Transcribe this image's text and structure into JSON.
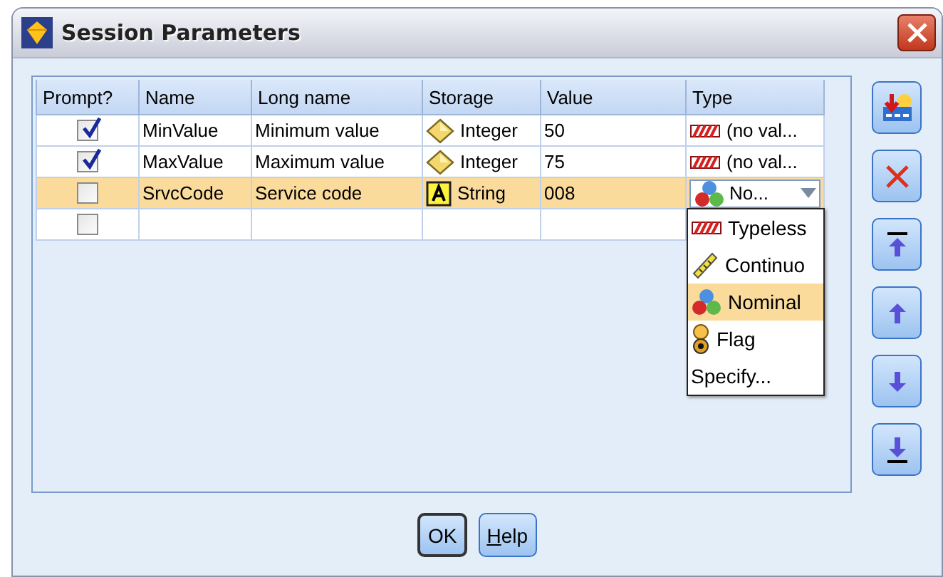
{
  "window": {
    "title": "Session Parameters"
  },
  "table": {
    "columns": [
      "Prompt?",
      "Name",
      "Long name",
      "Storage",
      "Value",
      "Type"
    ],
    "rows": [
      {
        "prompt": true,
        "selected": false,
        "name": "MinValue",
        "long_name": "Minimum value",
        "storage": {
          "kind": "integer",
          "label": "Integer"
        },
        "value": "50",
        "type": {
          "kind": "typeless",
          "label": "(no val...",
          "dropdown": false
        }
      },
      {
        "prompt": true,
        "selected": false,
        "name": "MaxValue",
        "long_name": "Maximum value",
        "storage": {
          "kind": "integer",
          "label": "Integer"
        },
        "value": "75",
        "type": {
          "kind": "typeless",
          "label": "(no val...",
          "dropdown": false
        }
      },
      {
        "prompt": false,
        "selected": true,
        "name": "SrvcCode",
        "long_name": "Service code",
        "storage": {
          "kind": "string",
          "label": "String"
        },
        "value": "008",
        "type": {
          "kind": "nominal",
          "label": "No...",
          "dropdown": true
        }
      },
      {
        "prompt": false,
        "selected": false
      }
    ],
    "type_menu": [
      {
        "kind": "typeless",
        "label": "Typeless",
        "selected": false
      },
      {
        "kind": "continuous",
        "label": "Continuo",
        "selected": false
      },
      {
        "kind": "nominal",
        "label": "Nominal",
        "selected": true
      },
      {
        "kind": "flag",
        "label": "Flag",
        "selected": false
      },
      {
        "kind": "text",
        "label": "Specify...",
        "selected": false
      }
    ]
  },
  "toolbar": [
    {
      "kind": "add"
    },
    {
      "kind": "delete"
    },
    {
      "kind": "top"
    },
    {
      "kind": "up"
    },
    {
      "kind": "down"
    },
    {
      "kind": "bottom"
    }
  ],
  "buttons": [
    {
      "label": "OK",
      "default": true,
      "underline_first": false
    },
    {
      "label": "Help",
      "default": false,
      "underline_first": true
    }
  ]
}
